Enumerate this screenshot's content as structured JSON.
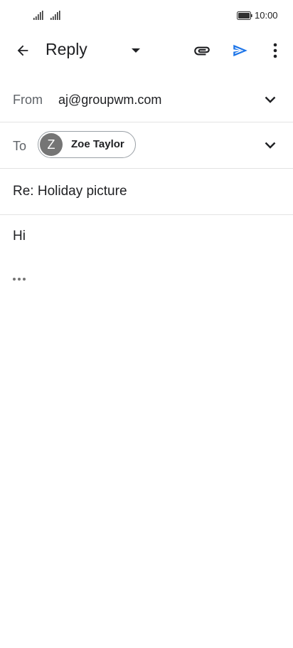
{
  "status_bar": {
    "time": "10:00"
  },
  "app_bar": {
    "title": "Reply",
    "send_color": "#1a73e8"
  },
  "compose": {
    "from_label": "From",
    "from_value": "aj@groupwm.com",
    "to_label": "To",
    "recipient": {
      "initial": "Z",
      "name": "Zoe Taylor",
      "avatar_color": "#757575"
    },
    "subject": "Re: Holiday picture",
    "body": "Hi"
  },
  "icons": {
    "back": "arrow-left-icon",
    "dropdown": "caret-down-icon",
    "attach": "paperclip-icon",
    "send": "send-icon",
    "more": "more-vert-icon",
    "expand": "chevron-down-icon",
    "quoted": "ellipsis-icon"
  }
}
